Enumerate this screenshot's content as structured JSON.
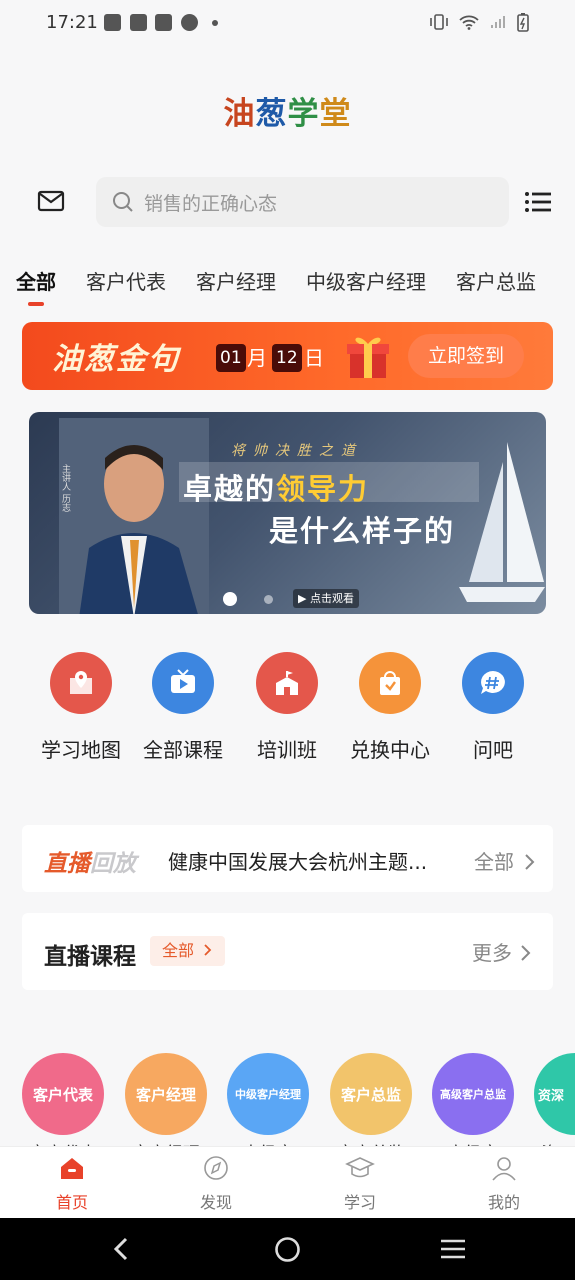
{
  "status_bar": {
    "time": "17:21"
  },
  "header": {
    "logo_chars": [
      "油",
      "葱",
      "学",
      "堂"
    ],
    "search_placeholder": "销售的正确心态"
  },
  "tabs": [
    {
      "label": "全部",
      "active": true
    },
    {
      "label": "客户代表"
    },
    {
      "label": "客户经理"
    },
    {
      "label": "中级客户经理"
    },
    {
      "label": "客户总监"
    }
  ],
  "signin_banner": {
    "title": "油葱金句",
    "month": "01",
    "month_unit": "月",
    "day": "12",
    "day_unit": "日",
    "button": "立即签到"
  },
  "hero_banner": {
    "speaker_label": "主讲人 历志",
    "slogan": "将帅决胜之道",
    "line1_prefix": "卓越的",
    "line1_highlight": "领导力",
    "line2": "是什么样子的",
    "play_label": "▶ 点击观看",
    "slide_count": 2,
    "active_slide": 1
  },
  "quick_entries": [
    {
      "label": "学习地图",
      "icon": "map-pin-icon",
      "color": "#e4574b"
    },
    {
      "label": "全部课程",
      "icon": "tv-play-icon",
      "color": "#3d86e0"
    },
    {
      "label": "培训班",
      "icon": "school-icon",
      "color": "#e4574b"
    },
    {
      "label": "兑换中心",
      "icon": "exchange-bag-icon",
      "color": "#f5933a"
    },
    {
      "label": "问吧",
      "icon": "hashtag-chat-icon",
      "color": "#3d86e0"
    }
  ],
  "replay": {
    "logo_part1": "直播",
    "logo_part2": "回放",
    "title": "健康中国发展大会杭州主题...",
    "all_label": "全部"
  },
  "live_courses": {
    "title": "直播课程",
    "tag": "全部",
    "more": "更多"
  },
  "roles": [
    {
      "label": "客户代表",
      "sub": "客户代表",
      "color": "#f06a8a"
    },
    {
      "label": "客户经理",
      "sub": "客户经理",
      "color": "#f7a860"
    },
    {
      "label": "中级客户经理",
      "sub": "中级客",
      "color": "#5aa6f5"
    },
    {
      "label": "客户总监",
      "sub": "客户总监",
      "color": "#f2c46b"
    },
    {
      "label": "高级客户总监",
      "sub": "高级客",
      "color": "#8a6ff0"
    },
    {
      "label": "资深",
      "sub": "资",
      "color": "#2fc7a8"
    }
  ],
  "bottom_nav": [
    {
      "label": "首页",
      "icon": "home-icon",
      "active": true
    },
    {
      "label": "发现",
      "icon": "compass-icon"
    },
    {
      "label": "学习",
      "icon": "graduation-cap-icon"
    },
    {
      "label": "我的",
      "icon": "user-icon"
    }
  ]
}
